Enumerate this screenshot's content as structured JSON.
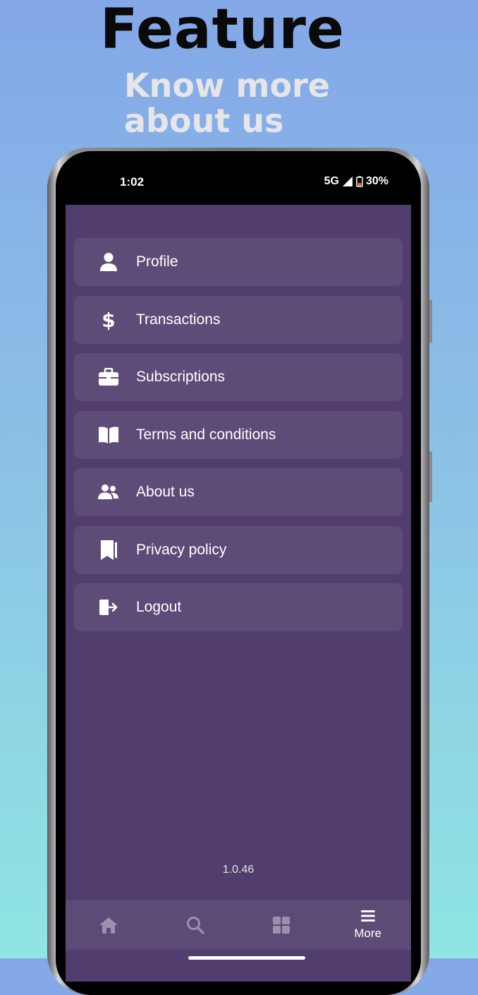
{
  "promo": {
    "headline": "Feature",
    "subline": "Know more about us"
  },
  "statusbar": {
    "time": "1:02",
    "network": "5G",
    "battery": "30%"
  },
  "menu": {
    "items": [
      {
        "label": "Profile",
        "icon": "person-icon"
      },
      {
        "label": "Transactions",
        "icon": "dollar-icon"
      },
      {
        "label": "Subscriptions",
        "icon": "briefcase-icon"
      },
      {
        "label": "Terms and conditions",
        "icon": "book-icon"
      },
      {
        "label": "About us",
        "icon": "users-icon"
      },
      {
        "label": "Privacy policy",
        "icon": "bookmark-icon"
      },
      {
        "label": "Logout",
        "icon": "logout-icon"
      }
    ]
  },
  "version": "1.0.46",
  "navbar": {
    "items": [
      {
        "label": "",
        "icon": "home-icon",
        "active": false
      },
      {
        "label": "",
        "icon": "search-icon",
        "active": false
      },
      {
        "label": "",
        "icon": "grid-icon",
        "active": false
      },
      {
        "label": "More",
        "icon": "menu-icon",
        "active": true
      }
    ]
  },
  "colors": {
    "screen_bg": "#513e6e",
    "item_bg": "#5e4c78",
    "nav_bg": "#5c4a77",
    "inactive_icon": "#9c90ad"
  }
}
